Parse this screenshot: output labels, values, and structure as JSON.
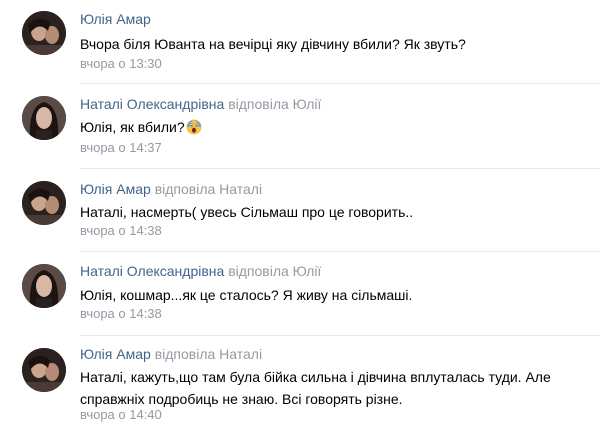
{
  "comments": [
    {
      "author": "Юлія Амар",
      "reply": "",
      "text": "Вчора біля Юванта на вечірці яку дівчину вбили? Як звуть?",
      "time": "вчора о 13:30",
      "avatar": "avatar-photo-yuliia"
    },
    {
      "author": "Наталі Олександрівна",
      "reply": "відповіла Юлії",
      "text": "Юлія, як вбили?",
      "emoji": "screaming-face-emoji",
      "time": "вчора о 14:37",
      "avatar": "avatar-photo-natali"
    },
    {
      "author": "Юлія Амар",
      "reply": "відповіла Наталі",
      "text": "Наталі, насмерть( увесь Сільмаш про це говорить..",
      "time": "вчора о 14:38",
      "avatar": "avatar-photo-yuliia"
    },
    {
      "author": "Наталі Олександрівна",
      "reply": "відповіла Юлії",
      "text": "Юлія, кошмар...як це сталось? Я живу на сільмаші.",
      "time": "вчора о 14:38",
      "avatar": "avatar-photo-natali"
    },
    {
      "author": "Юлія Амар",
      "reply": "відповіла Наталі",
      "text_line1": "Наталі, кажуть,що там була бійка сильна і дівчина вплуталась туди. Але",
      "text_line2": "справжніх подробиць не знаю. Всі говорять різне.",
      "time": "вчора о 14:40",
      "avatar": "avatar-photo-yuliia"
    }
  ],
  "colors": {
    "author": "#42648b",
    "meta": "#939aa3",
    "separator": "#e7e8ec"
  }
}
